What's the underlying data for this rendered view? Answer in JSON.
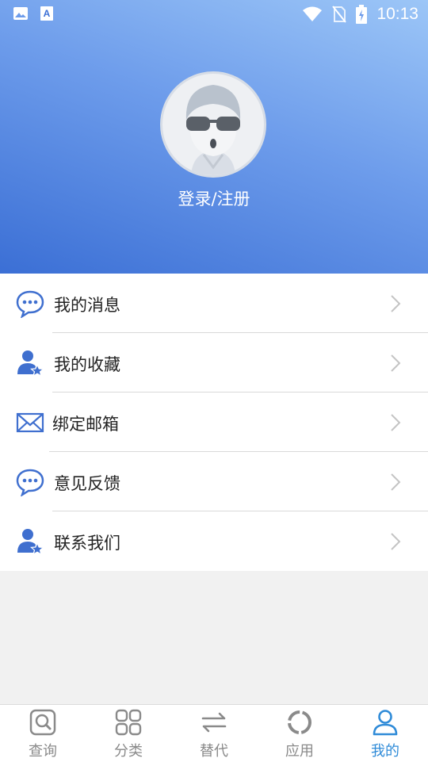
{
  "status_bar": {
    "time": "10:13",
    "left_icons": [
      "image-icon",
      "font-a-icon"
    ],
    "right_icons": [
      "wifi-icon",
      "no-sim-icon",
      "battery-charging-icon"
    ]
  },
  "profile": {
    "login_label": "登录/注册"
  },
  "menu": {
    "items": [
      {
        "label": "我的消息",
        "icon": "chat-bubble-icon"
      },
      {
        "label": "我的收藏",
        "icon": "user-star-icon"
      },
      {
        "label": "绑定邮箱",
        "icon": "envelope-icon"
      },
      {
        "label": "意见反馈",
        "icon": "chat-bubble-icon"
      },
      {
        "label": "联系我们",
        "icon": "user-star-icon"
      }
    ]
  },
  "bottom_nav": {
    "items": [
      {
        "label": "查询",
        "icon": "search-icon",
        "active": false
      },
      {
        "label": "分类",
        "icon": "grid-icon",
        "active": false
      },
      {
        "label": "替代",
        "icon": "swap-arrows-icon",
        "active": false
      },
      {
        "label": "应用",
        "icon": "ring-icon",
        "active": false
      },
      {
        "label": "我的",
        "icon": "user-icon",
        "active": true
      }
    ]
  },
  "colors": {
    "accent": "#2f8bd8",
    "icon_blue": "#3f6fcf",
    "header_start": "#9cc6f7",
    "header_end": "#3b6fd5"
  }
}
